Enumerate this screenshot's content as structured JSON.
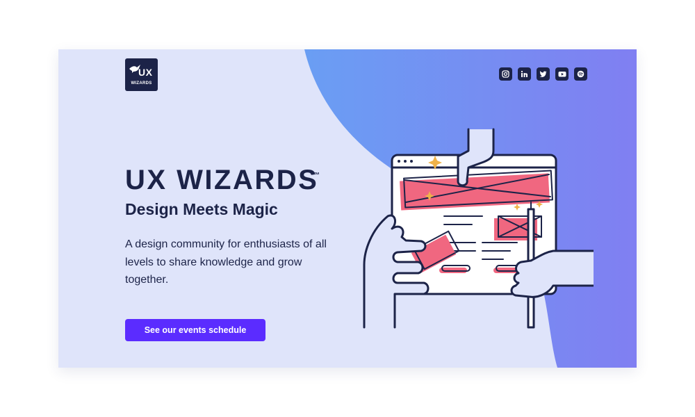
{
  "brand": {
    "logo_text": "UX",
    "logo_subtext": "WIZARDS"
  },
  "social": [
    {
      "name": "instagram",
      "icon": "instagram-icon"
    },
    {
      "name": "linkedin",
      "icon": "linkedin-icon"
    },
    {
      "name": "twitter",
      "icon": "twitter-icon"
    },
    {
      "name": "youtube",
      "icon": "youtube-icon"
    },
    {
      "name": "spotify",
      "icon": "spotify-icon"
    }
  ],
  "hero": {
    "title": "UX WIZARDS",
    "trademark": "™",
    "subtitle": "Design Meets Magic",
    "description": "A design community for enthusiasts of all levels to share knowledge and grow together.",
    "cta_label": "See our events schedule"
  },
  "colors": {
    "background": "#dfe4fa",
    "accent_gradient_start": "#6a9ef3",
    "accent_gradient_end": "#7f7ff2",
    "navy": "#1c2348",
    "button": "#5b2cff",
    "illustration_pink": "#f06780",
    "sparkle": "#f0b34a"
  }
}
